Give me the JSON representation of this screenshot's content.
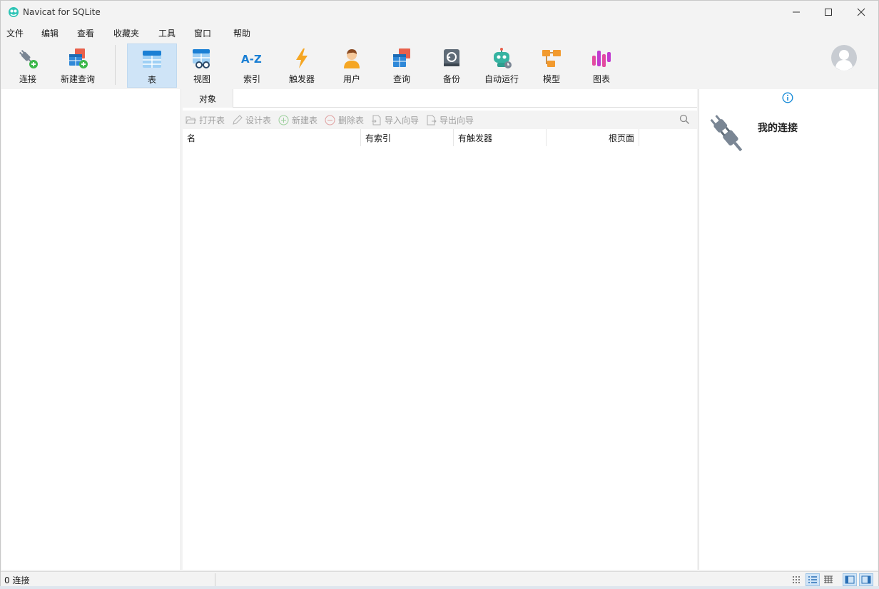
{
  "window": {
    "title": "Navicat for SQLite"
  },
  "menu": [
    "文件",
    "编辑",
    "查看",
    "收藏夹",
    "工具",
    "窗口",
    "帮助"
  ],
  "toolbar": {
    "connect": "连接",
    "new_query": "新建查询",
    "items": [
      "表",
      "视图",
      "索引",
      "触发器",
      "用户",
      "查询",
      "备份",
      "自动运行",
      "模型",
      "图表"
    ],
    "active": "表"
  },
  "center": {
    "tab": "对象",
    "actions": {
      "open": "打开表",
      "design": "设计表",
      "new": "新建表",
      "delete": "删除表",
      "import": "导入向导",
      "export": "导出向导"
    },
    "columns": [
      "名",
      "有索引",
      "有触发器",
      "根页面"
    ]
  },
  "right": {
    "heading": "我的连接"
  },
  "status": {
    "connections": "0 连接"
  },
  "colors": {
    "accent": "#1a8cd8",
    "active_bg": "#cfe4f7"
  }
}
